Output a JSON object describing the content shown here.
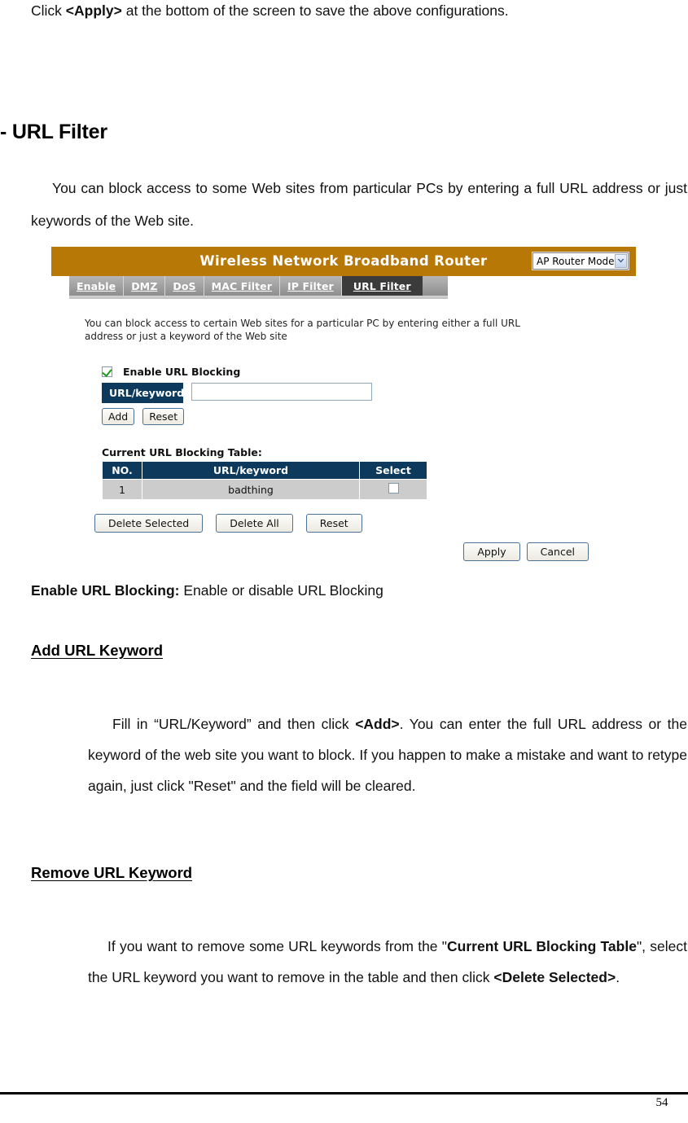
{
  "document": {
    "intro_prefix": "Click ",
    "intro_bold": "<Apply>",
    "intro_suffix": " at the bottom of the screen to save the above configurations.",
    "section_title": "- URL Filter",
    "lead_paragraph": "You can block access to some Web sites from particular PCs by entering a full URL address or just keywords of the Web site.",
    "enable_term": "Enable URL Blocking:",
    "enable_desc": " Enable or disable URL Blocking",
    "add_heading": "Add URL Keyword",
    "add_p1": "Fill in “URL/Keyword” and then click ",
    "add_bold": "<Add>",
    "add_p2": ". You can enter the full URL address or the keyword of the web site you want to block. If you happen to make a mistake and want to retype again, just click \"Reset\" and the field will be cleared.",
    "remove_heading": "Remove URL Keyword",
    "remove_p1": "If you want to remove some URL keywords from the \"",
    "remove_bold1": "Current URL Blocking Table",
    "remove_p2": "\", select the URL keyword you want to remove in the table and then click ",
    "remove_bold2": "<Delete Selected>",
    "remove_p3": ".",
    "page_number": "54"
  },
  "router_ui": {
    "title": "Wireless Network Broadband Router",
    "mode_selected": "AP Router Mode",
    "header_color": "#b87806",
    "accent_color": "#0d3a5c",
    "tabs": [
      {
        "label": "Enable",
        "active": false
      },
      {
        "label": "DMZ",
        "active": false
      },
      {
        "label": "DoS",
        "active": false
      },
      {
        "label": "MAC Filter",
        "active": false
      },
      {
        "label": "IP Filter",
        "active": false
      },
      {
        "label": "URL Filter",
        "active": true
      }
    ],
    "description": "You can block access to certain Web sites for a particular PC by entering either a full URL address or just a keyword of the Web site",
    "enable_checkbox": {
      "label": "Enable URL Blocking",
      "checked": true
    },
    "keyword_field": {
      "label": "URL/keyword",
      "value": "",
      "placeholder": ""
    },
    "form_buttons": {
      "add": "Add",
      "reset": "Reset"
    },
    "table": {
      "caption": "Current URL Blocking Table:",
      "columns": [
        "NO.",
        "URL/keyword",
        "Select"
      ],
      "rows": [
        {
          "no": "1",
          "keyword": "badthing",
          "selected": false
        }
      ]
    },
    "table_buttons": {
      "delete_selected": "Delete Selected",
      "delete_all": "Delete All",
      "reset": "Reset"
    },
    "footer_buttons": {
      "apply": "Apply",
      "cancel": "Cancel"
    }
  }
}
